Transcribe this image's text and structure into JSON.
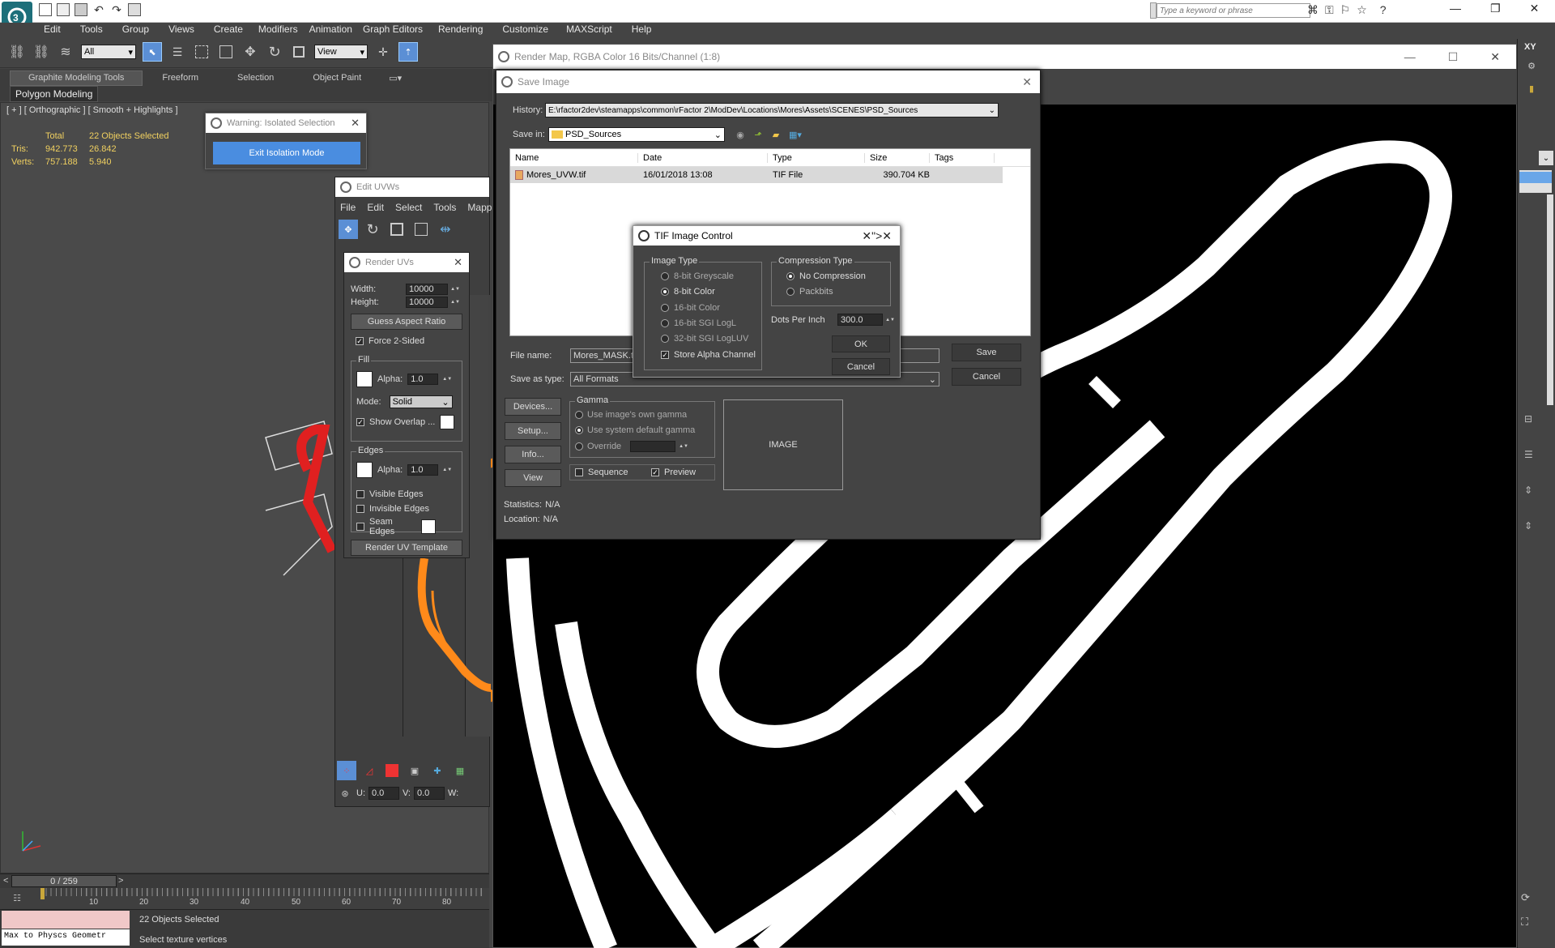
{
  "menubar": {
    "items": [
      "Edit",
      "Tools",
      "Group",
      "Views",
      "Create",
      "Modifiers",
      "Animation",
      "Graph Editors",
      "Rendering",
      "Customize",
      "MAXScript",
      "Help"
    ],
    "search_placeholder": "Type a keyword or phrase"
  },
  "toolbar": {
    "selection_filter": "All",
    "ref_coord": "View"
  },
  "ribbon": {
    "tabs": [
      "Graphite Modeling Tools",
      "Freeform",
      "Selection",
      "Object Paint"
    ],
    "subtab": "Polygon Modeling"
  },
  "viewport": {
    "label": "[ + ] [ Orthographic ] [ Smooth + Highlights ]",
    "stats": {
      "total_label": "Total",
      "total_value": "22 Objects Selected",
      "tris_label": "Tris:",
      "tris_total": "942.773",
      "tris_sel": "26.842",
      "verts_label": "Verts:",
      "verts_total": "757.188",
      "verts_sel": "5.940"
    }
  },
  "warning_dialog": {
    "title": "Warning: Isolated Selection",
    "button": "Exit Isolation Mode"
  },
  "edit_uvws": {
    "title": "Edit UVWs",
    "menu": [
      "File",
      "Edit",
      "Select",
      "Tools",
      "Mapp"
    ],
    "u_label": "U:",
    "u_value": "0.0",
    "v_label": "V:",
    "v_value": "0.0",
    "w_label": "W:"
  },
  "render_uvs": {
    "title": "Render UVs",
    "width_label": "Width:",
    "width_value": "10000",
    "height_label": "Height:",
    "height_value": "10000",
    "guess_aspect": "Guess Aspect Ratio",
    "force_2sided": "Force 2-Sided",
    "fill_label": "Fill",
    "alpha_label": "Alpha:",
    "fill_alpha": "1.0",
    "mode_label": "Mode:",
    "mode_value": "Solid",
    "show_overlap": "Show Overlap ...",
    "edges_label": "Edges",
    "edges_alpha": "1.0",
    "visible_edges": "Visible Edges",
    "invisible_edges": "Invisible Edges",
    "seam_edges": "Seam Edges",
    "render_template": "Render UV Template"
  },
  "render_map": {
    "title": "Render Map, RGBA Color 16 Bits/Channel (1:8)"
  },
  "save_image": {
    "title": "Save Image",
    "history_label": "History:",
    "history_value": "E:\\rfactor2dev\\steamapps\\common\\rFactor 2\\ModDev\\Locations\\Mores\\Assets\\SCENES\\PSD_Sources",
    "savein_label": "Save in:",
    "savein_value": "PSD_Sources",
    "columns": [
      "Name",
      "Date",
      "Type",
      "Size",
      "Tags"
    ],
    "files": [
      {
        "name": "Mores_UVW.tif",
        "date": "16/01/2018 13:08",
        "type": "TIF File",
        "size": "390.704 KB",
        "tags": ""
      }
    ],
    "filename_label": "File name:",
    "filename_value": "Mores_MASK.ti",
    "savetype_label": "Save as type:",
    "savetype_value": "All Formats",
    "save_button": "Save",
    "cancel_button": "Cancel",
    "devices_button": "Devices...",
    "setup_button": "Setup...",
    "info_button": "Info...",
    "view_button": "View",
    "gamma_label": "Gamma",
    "gamma_own": "Use image's own gamma",
    "gamma_default": "Use system default gamma",
    "gamma_override": "Override",
    "sequence_label": "Sequence",
    "preview_label": "Preview",
    "image_label": "IMAGE",
    "statistics_label": "Statistics:",
    "statistics_value": "N/A",
    "location_label": "Location:",
    "location_value": "N/A"
  },
  "tif_control": {
    "title": "TIF Image Control",
    "image_type_label": "Image Type",
    "image_types": [
      "8-bit Greyscale",
      "8-bit Color",
      "16-bit Color",
      "16-bit SGI LogL",
      "32-bit SGI LogLUV"
    ],
    "store_alpha": "Store Alpha Channel",
    "compression_label": "Compression Type",
    "compressions": [
      "No Compression",
      "Packbits"
    ],
    "dpi_label": "Dots Per Inch",
    "dpi_value": "300.0",
    "ok_button": "OK",
    "cancel_button": "Cancel"
  },
  "timeline": {
    "frame_counter": "0 / 259",
    "ticks": [
      "10",
      "20",
      "30",
      "40",
      "50",
      "60",
      "70",
      "80"
    ]
  },
  "status": {
    "script_listener": "Max to Physcs Geometr",
    "selected": "22 Objects Selected",
    "prompt": "Select texture vertices"
  },
  "right_panel": {
    "axis_label": "XY"
  }
}
